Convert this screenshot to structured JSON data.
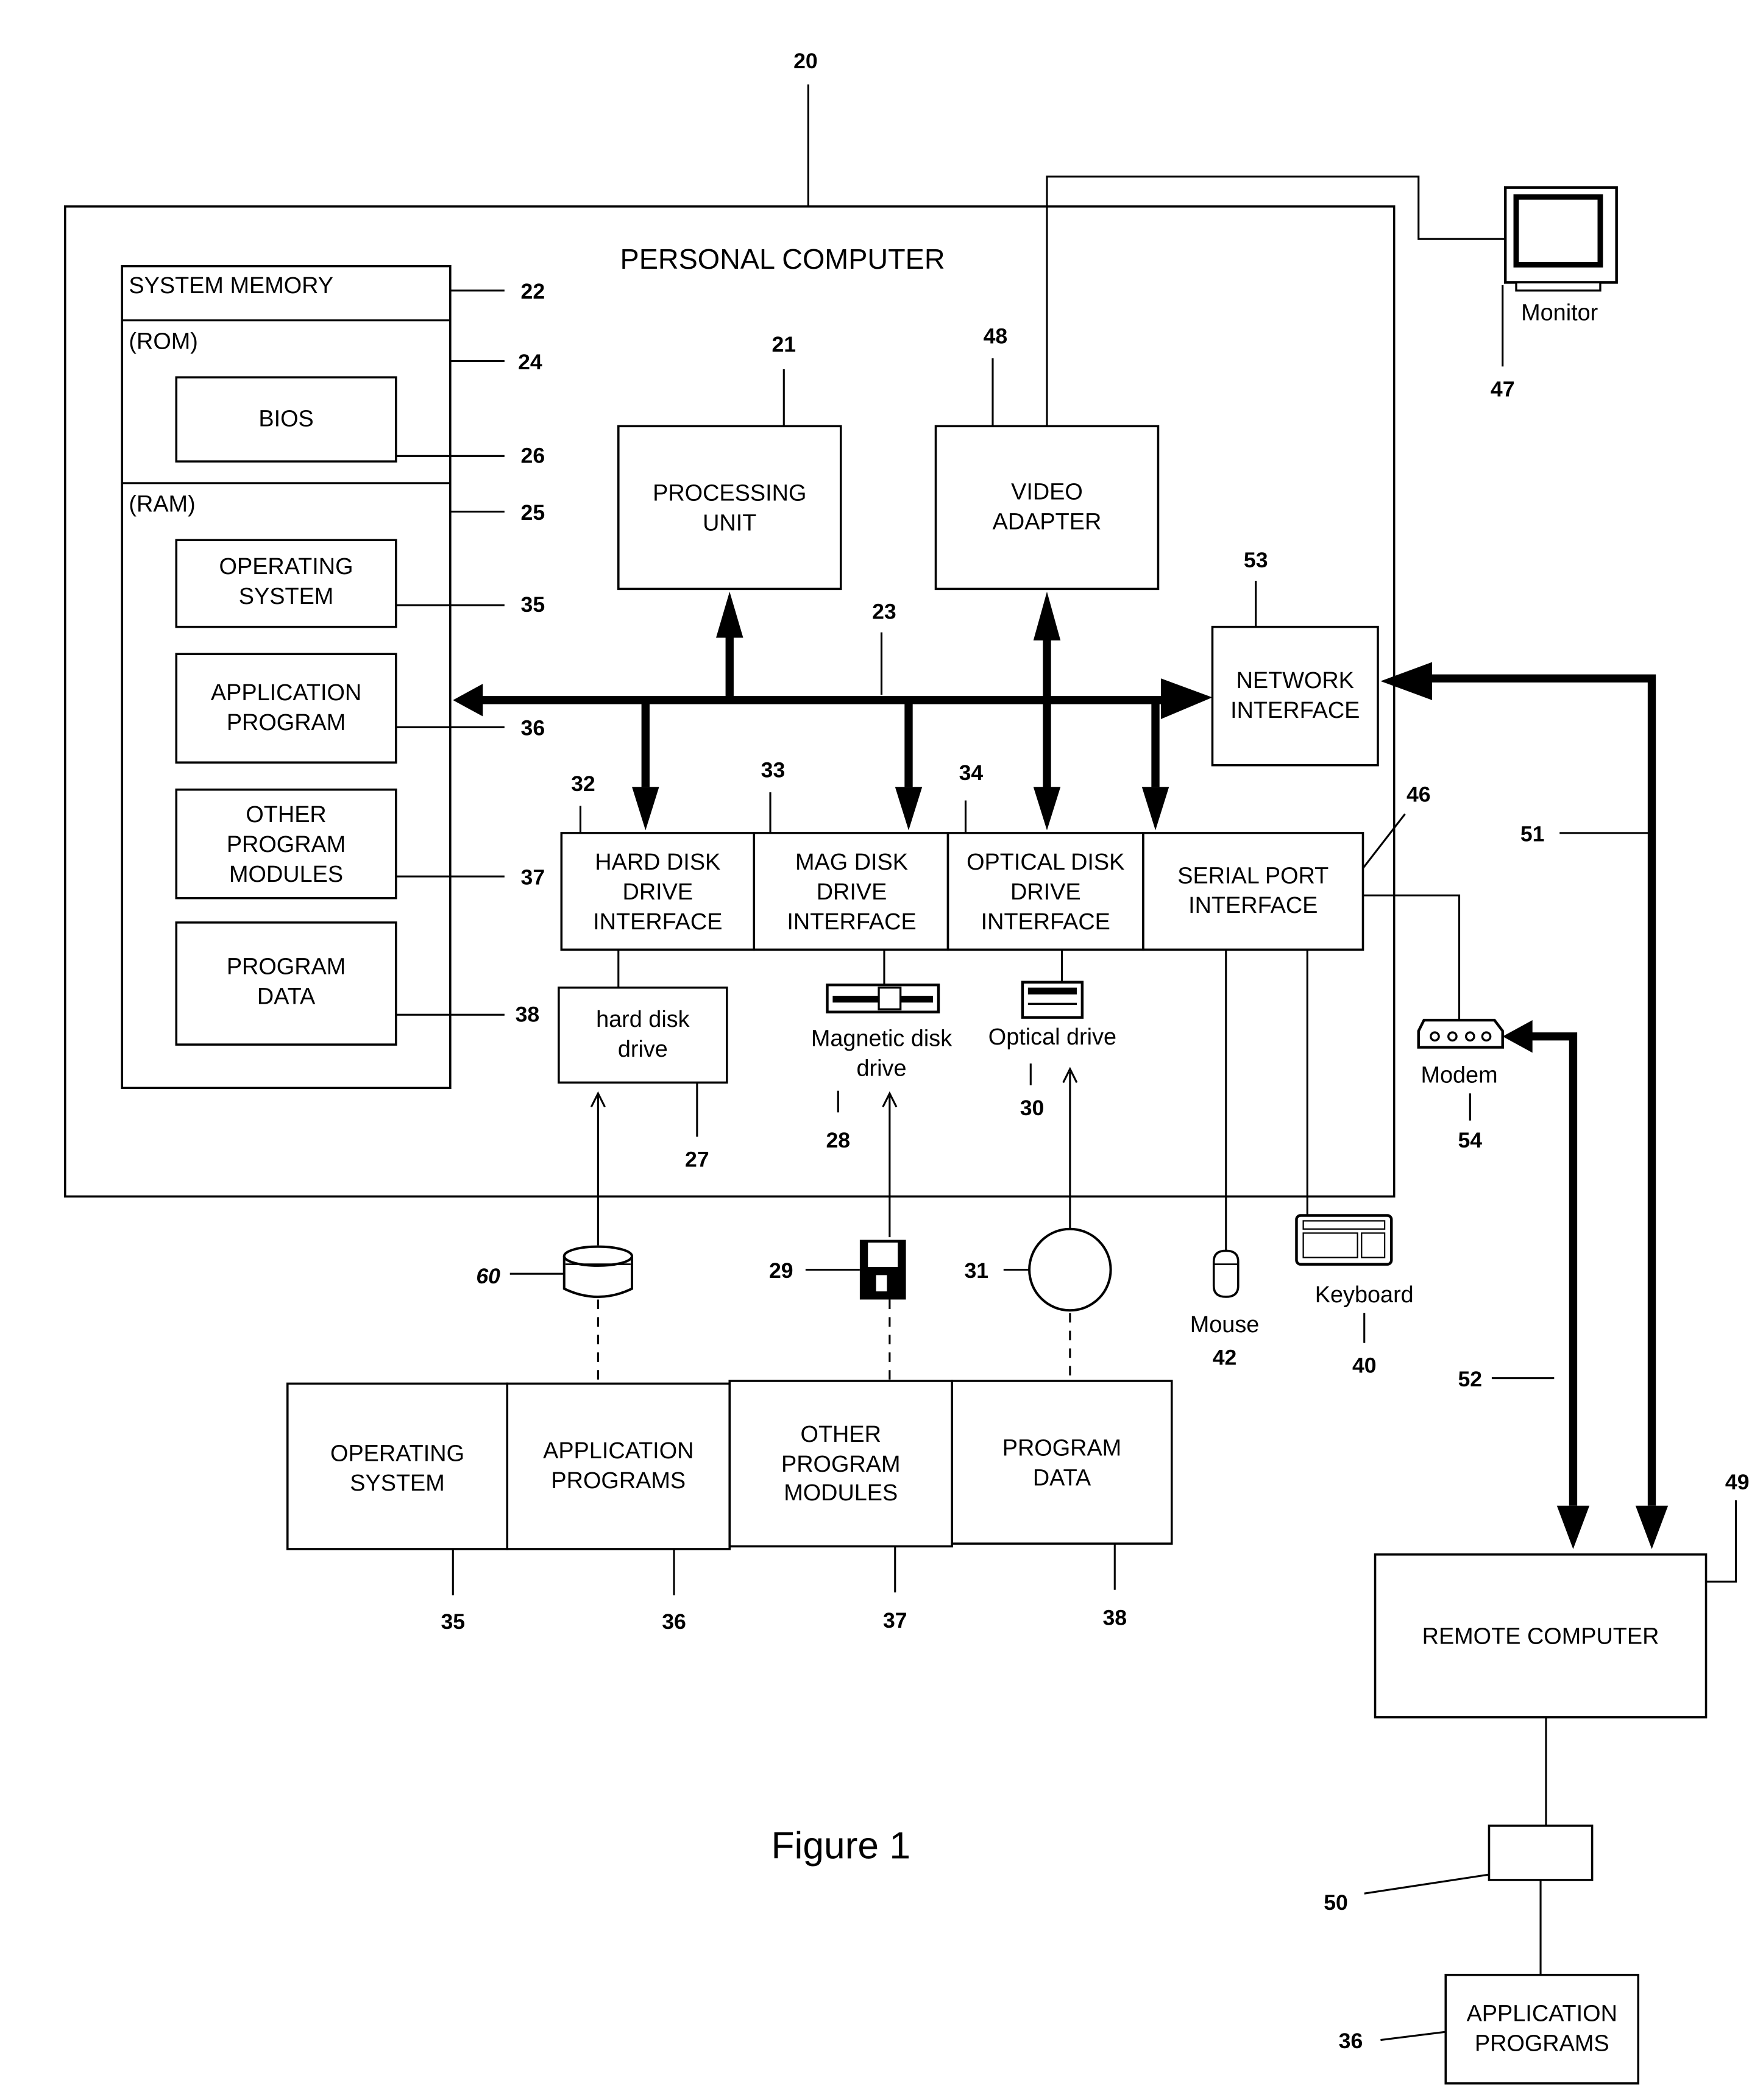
{
  "figure": {
    "caption": "Figure 1",
    "title_ref": "20",
    "personal_computer_label": "PERSONAL COMPUTER"
  },
  "system_memory": {
    "label": "SYSTEM MEMORY",
    "ref": "22",
    "rom": {
      "label": "(ROM)",
      "ref": "24"
    },
    "bios": {
      "label": "BIOS",
      "ref": "26"
    },
    "ram": {
      "label": "(RAM)",
      "ref": "25"
    },
    "operating_system": {
      "line1": "OPERATING",
      "line2": "SYSTEM",
      "ref": "35"
    },
    "application_program": {
      "line1": "APPLICATION",
      "line2": "PROGRAM",
      "ref": "36"
    },
    "other_program_modules": {
      "line1": "OTHER",
      "line2": "PROGRAM",
      "line3": "MODULES",
      "ref": "37"
    },
    "program_data": {
      "line1": "PROGRAM",
      "line2": "DATA",
      "ref": "38"
    }
  },
  "processing_unit": {
    "line1": "PROCESSING",
    "line2": "UNIT",
    "ref": "21"
  },
  "video_adapter": {
    "line1": "VIDEO",
    "line2": "ADAPTER",
    "ref": "48"
  },
  "system_bus": {
    "ref": "23"
  },
  "network_interface": {
    "line1": "NETWORK",
    "line2": "INTERFACE",
    "ref": "53"
  },
  "interfaces": {
    "hard_disk": {
      "line1": "HARD DISK",
      "line2": "DRIVE",
      "line3": "INTERFACE",
      "ref": "32"
    },
    "mag_disk": {
      "line1": "MAG DISK",
      "line2": "DRIVE",
      "line3": "INTERFACE",
      "ref": "33"
    },
    "optical_disk": {
      "line1": "OPTICAL DISK",
      "line2": "DRIVE",
      "line3": "INTERFACE",
      "ref": "34"
    },
    "serial_port": {
      "line1": "SERIAL PORT",
      "line2": "INTERFACE",
      "ref": "46"
    }
  },
  "drives": {
    "hard_disk_drive": {
      "line1": "hard disk",
      "line2": "drive",
      "ref": "27"
    },
    "magnetic_disk_drive": {
      "line1": "Magnetic disk",
      "line2": "drive",
      "ref": "28"
    },
    "optical_drive": {
      "label": "Optical drive",
      "ref": "30"
    }
  },
  "media": {
    "hard_disk_media_ref": "60",
    "floppy_ref": "29",
    "optical_disc_ref": "31"
  },
  "peripherals": {
    "monitor": {
      "label": "Monitor",
      "ref": "47"
    },
    "modem": {
      "label": "Modem",
      "ref": "54"
    },
    "mouse": {
      "label": "Mouse",
      "ref": "42"
    },
    "keyboard": {
      "label": "Keyboard",
      "ref": "40"
    }
  },
  "program_row": {
    "operating_system": {
      "line1": "OPERATING",
      "line2": "SYSTEM",
      "ref": "35"
    },
    "application_programs": {
      "line1": "APPLICATION",
      "line2": "PROGRAMS",
      "ref": "36"
    },
    "other_program_modules": {
      "line1": "OTHER",
      "line2": "PROGRAM",
      "line3": "MODULES",
      "ref": "37"
    },
    "program_data": {
      "line1": "PROGRAM",
      "line2": "DATA",
      "ref": "38"
    }
  },
  "network": {
    "lan_ref": "51",
    "wan_ref": "52"
  },
  "remote_computer": {
    "label": "REMOTE COMPUTER",
    "ref": "49"
  },
  "remote_storage": {
    "ref": "50"
  },
  "remote_application_programs": {
    "line1": "APPLICATION",
    "line2": "PROGRAMS",
    "ref": "36"
  }
}
